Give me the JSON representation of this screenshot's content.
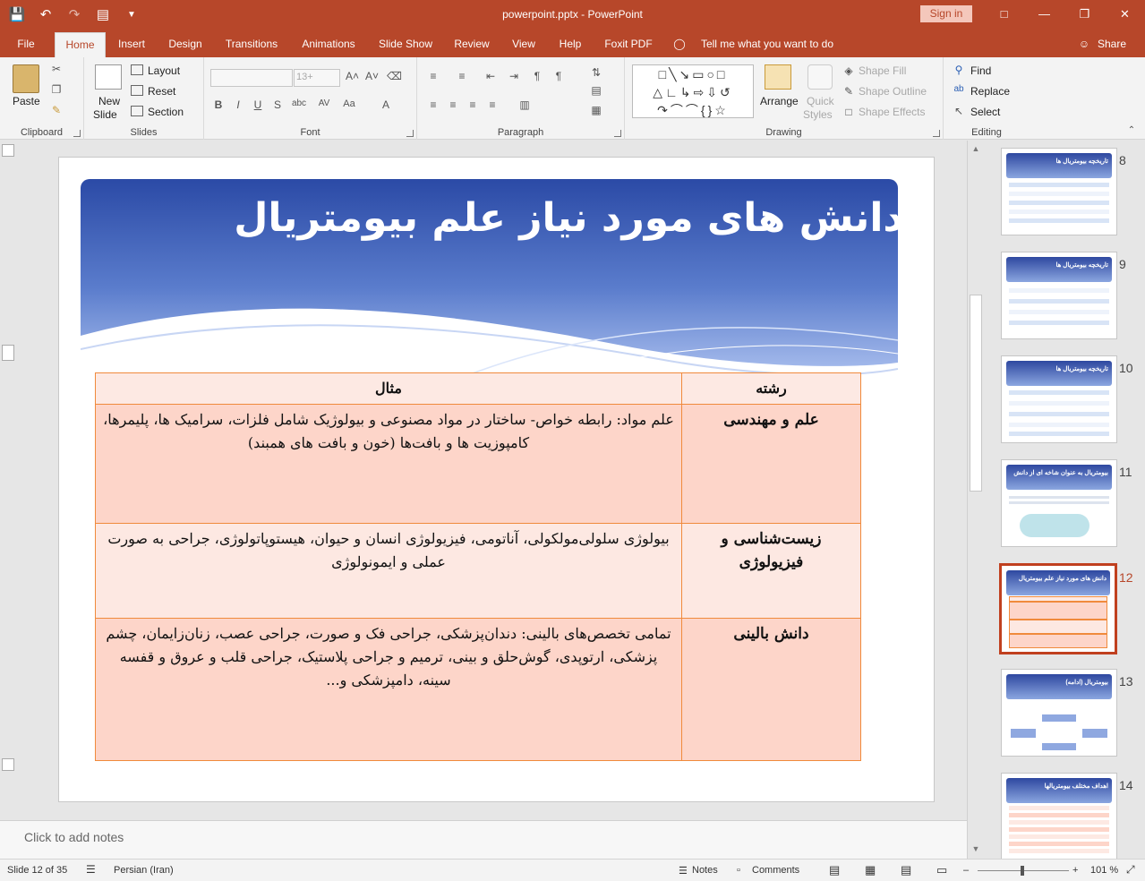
{
  "app": {
    "document_title": "powerpoint.pptx  -  PowerPoint",
    "sign_in": "Sign in"
  },
  "tabs": [
    "File",
    "Home",
    "Insert",
    "Design",
    "Transitions",
    "Animations",
    "Slide Show",
    "Review",
    "View",
    "Help",
    "Foxit PDF"
  ],
  "active_tab": "Home",
  "tell_me": "Tell me what you want to do",
  "share": "Share",
  "ribbon": {
    "clipboard": {
      "paste": "Paste",
      "label": "Clipboard"
    },
    "slides": {
      "new_slide_1": "New",
      "new_slide_2": "Slide",
      "layout": "Layout",
      "reset": "Reset",
      "section": "Section",
      "label": "Slides"
    },
    "font": {
      "size": "13+",
      "label": "Font"
    },
    "paragraph": {
      "label": "Paragraph"
    },
    "drawing": {
      "arrange": "Arrange",
      "quick_styles_1": "Quick",
      "quick_styles_2": "Styles",
      "shape_fill": "Shape Fill",
      "shape_outline": "Shape Outline",
      "shape_effects": "Shape Effects",
      "label": "Drawing"
    },
    "editing": {
      "find": "Find",
      "replace": "Replace",
      "select": "Select",
      "label": "Editing"
    }
  },
  "slide": {
    "title": "دانش های مورد نیاز علم بیومتریال",
    "table": {
      "headers": [
        "رشته",
        "مثال"
      ],
      "rows": [
        {
          "field": "علم و مهندسی",
          "example": "علم مواد: رابطه خواص- ساختار در مواد مصنوعی و بیولوژیک شامل فلزات، سرامیک ها، پلیمرها، کامپوزیت ها و بافت‌ها (خون و بافت های همبند)"
        },
        {
          "field": "زیست‌شناسی و فیزیولوژی",
          "example": "بیولوژی سلولی‌مولکولی، آناتومی، فیزیولوژی انسان و حیوان، هیستوپاتولوژی، جراحی به صورت عملی و ایمونولوژی"
        },
        {
          "field": "دانش بالینی",
          "example": "تمامی تخصص‌های بالینی: دندان‌پزشکی، جراحی فک و صورت، جراحی عصب، زنان‌زایمان، چشم پزشکی، ارتوپدی، گوش‌حلق و بینی، ترمیم و جراحی پلاستیک، جراحی قلب و عروق و قفسه سینه، دامپزشکی و..."
        }
      ]
    }
  },
  "thumbnails": [
    {
      "num": "8",
      "title": "تاریخچه بیومتریال ها",
      "active": false
    },
    {
      "num": "9",
      "title": "تاریخچه بیومتریال ها",
      "active": false
    },
    {
      "num": "10",
      "title": "تاریخچه بیومتریال ها",
      "active": false
    },
    {
      "num": "11",
      "title": "بیومتریال به عنوان شاخه ای از دانش",
      "active": false
    },
    {
      "num": "12",
      "title": "دانش های مورد نیاز علم بیومتریال",
      "active": true
    },
    {
      "num": "13",
      "title": "بیومتریال (ادامه)",
      "active": false
    },
    {
      "num": "14",
      "title": "اهداف مختلف بیومتریالها",
      "active": false
    }
  ],
  "notes_placeholder": "Click to add notes",
  "status": {
    "slide_of": "Slide 12 of 35",
    "language": "Persian (Iran)",
    "notes": "Notes",
    "comments": "Comments",
    "zoom": "101 %"
  },
  "colors": {
    "accent": "#b7472a",
    "table_border": "#f08a3c",
    "row_dark": "#fdd5c9",
    "row_light": "#fde8e2"
  }
}
